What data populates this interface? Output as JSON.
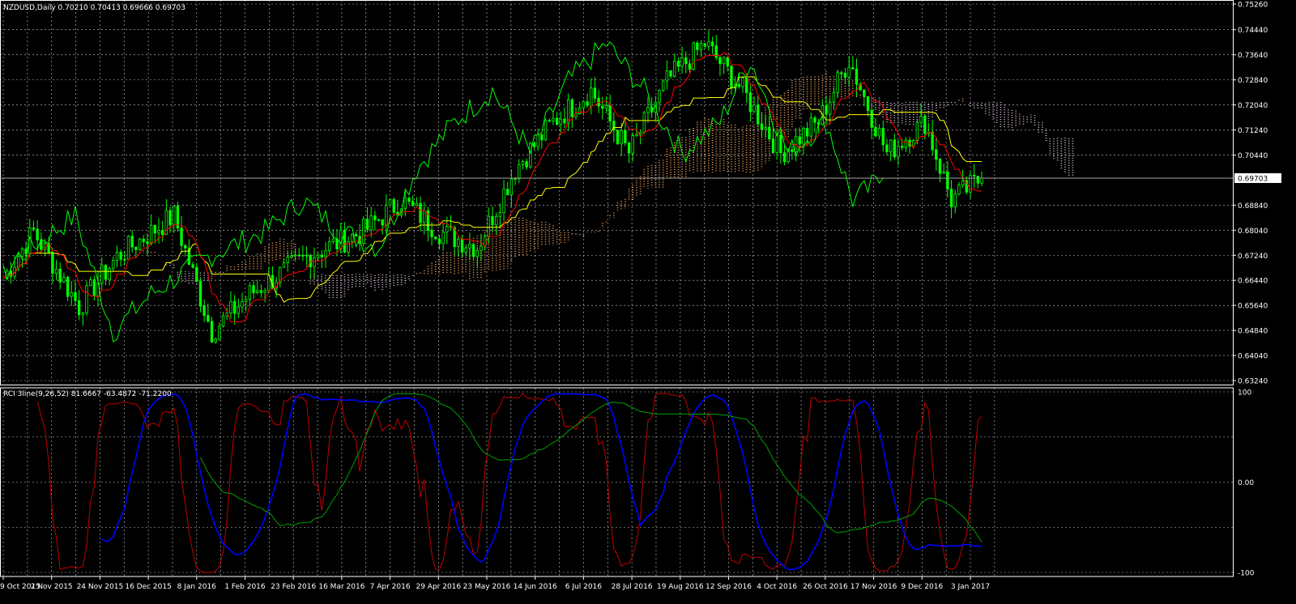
{
  "main_header": "NZDUSD,Daily  0.70210 0.70413 0.69666 0.69703",
  "sub_header": "RCI 3line(9,26,52) 81.6667 -63.4872 -71.2200",
  "current_price_label": "0.69703",
  "colors": {
    "background": "#000000",
    "frame": "#ffffff",
    "grid": "#c8c8c8",
    "candle_up": "#00ff00",
    "candle_down": "#00ff00",
    "tenkan": "#ff0000",
    "kijun": "#ffff00",
    "chikou": "#00ff00",
    "kumo_bull": "#f4a460",
    "kumo_bear": "#d8bfd8",
    "rci_short": "#c00000",
    "rci_mid": "#0000ff",
    "rci_long": "#00a000"
  },
  "chart_data": [
    {
      "type": "line",
      "title": "NZDUSD,Daily  0.70210 0.70413 0.69666 0.69703",
      "indicator": "Ichimoku Kinko Hyo with daily candlesticks",
      "ylim": [
        0.6324,
        0.7526
      ],
      "y_ticks": [
        "0.75260",
        "0.74440",
        "0.73640",
        "0.72840",
        "0.72040",
        "0.71240",
        "0.70440",
        "0.69703",
        "0.68840",
        "0.68040",
        "0.67240",
        "0.66440",
        "0.65640",
        "0.64840",
        "0.64040",
        "0.63240"
      ],
      "x_ticks": [
        "9 Oct 2015",
        "2 Nov 2015",
        "24 Nov 2015",
        "16 Dec 2015",
        "8 Jan 2016",
        "1 Feb 2016",
        "23 Feb 2016",
        "16 Mar 2016",
        "7 Apr 2016",
        "29 Apr 2016",
        "23 May 2016",
        "14 Jun 2016",
        "6 Jul 2016",
        "28 Jul 2016",
        "19 Aug 2016",
        "12 Sep 2016",
        "4 Oct 2016",
        "26 Oct 2016",
        "17 Nov 2016",
        "9 Dec 2016",
        "3 Jan 2017"
      ],
      "grid": true,
      "last_price": 0.69703,
      "price_path": [
        {
          "bar": 0,
          "close": 0.665
        },
        {
          "bar": 8,
          "close": 0.68
        },
        {
          "bar": 20,
          "close": 0.656
        },
        {
          "bar": 30,
          "close": 0.672
        },
        {
          "bar": 45,
          "close": 0.685
        },
        {
          "bar": 55,
          "close": 0.648
        },
        {
          "bar": 65,
          "close": 0.66
        },
        {
          "bar": 80,
          "close": 0.672
        },
        {
          "bar": 95,
          "close": 0.68
        },
        {
          "bar": 105,
          "close": 0.69
        },
        {
          "bar": 115,
          "close": 0.68
        },
        {
          "bar": 125,
          "close": 0.675
        },
        {
          "bar": 135,
          "close": 0.7
        },
        {
          "bar": 145,
          "close": 0.715
        },
        {
          "bar": 155,
          "close": 0.725
        },
        {
          "bar": 165,
          "close": 0.705
        },
        {
          "bar": 175,
          "close": 0.728
        },
        {
          "bar": 185,
          "close": 0.74
        },
        {
          "bar": 195,
          "close": 0.725
        },
        {
          "bar": 205,
          "close": 0.705
        },
        {
          "bar": 215,
          "close": 0.715
        },
        {
          "bar": 223,
          "close": 0.735
        },
        {
          "bar": 233,
          "close": 0.705
        },
        {
          "bar": 243,
          "close": 0.715
        },
        {
          "bar": 250,
          "close": 0.69
        },
        {
          "bar": 258,
          "close": 0.697
        }
      ],
      "total_bars": 258
    },
    {
      "type": "line",
      "title": "RCI 3line(9,26,52) 81.6667 -63.4872 -71.2200",
      "ylim": [
        -100,
        100
      ],
      "y_ticks": [
        "100",
        "0.00",
        "-100"
      ],
      "series": [
        {
          "name": "RCI 9",
          "last": 81.6667
        },
        {
          "name": "RCI 26",
          "last": -63.4872
        },
        {
          "name": "RCI 52",
          "last": -71.22
        }
      ],
      "grid": true
    }
  ]
}
